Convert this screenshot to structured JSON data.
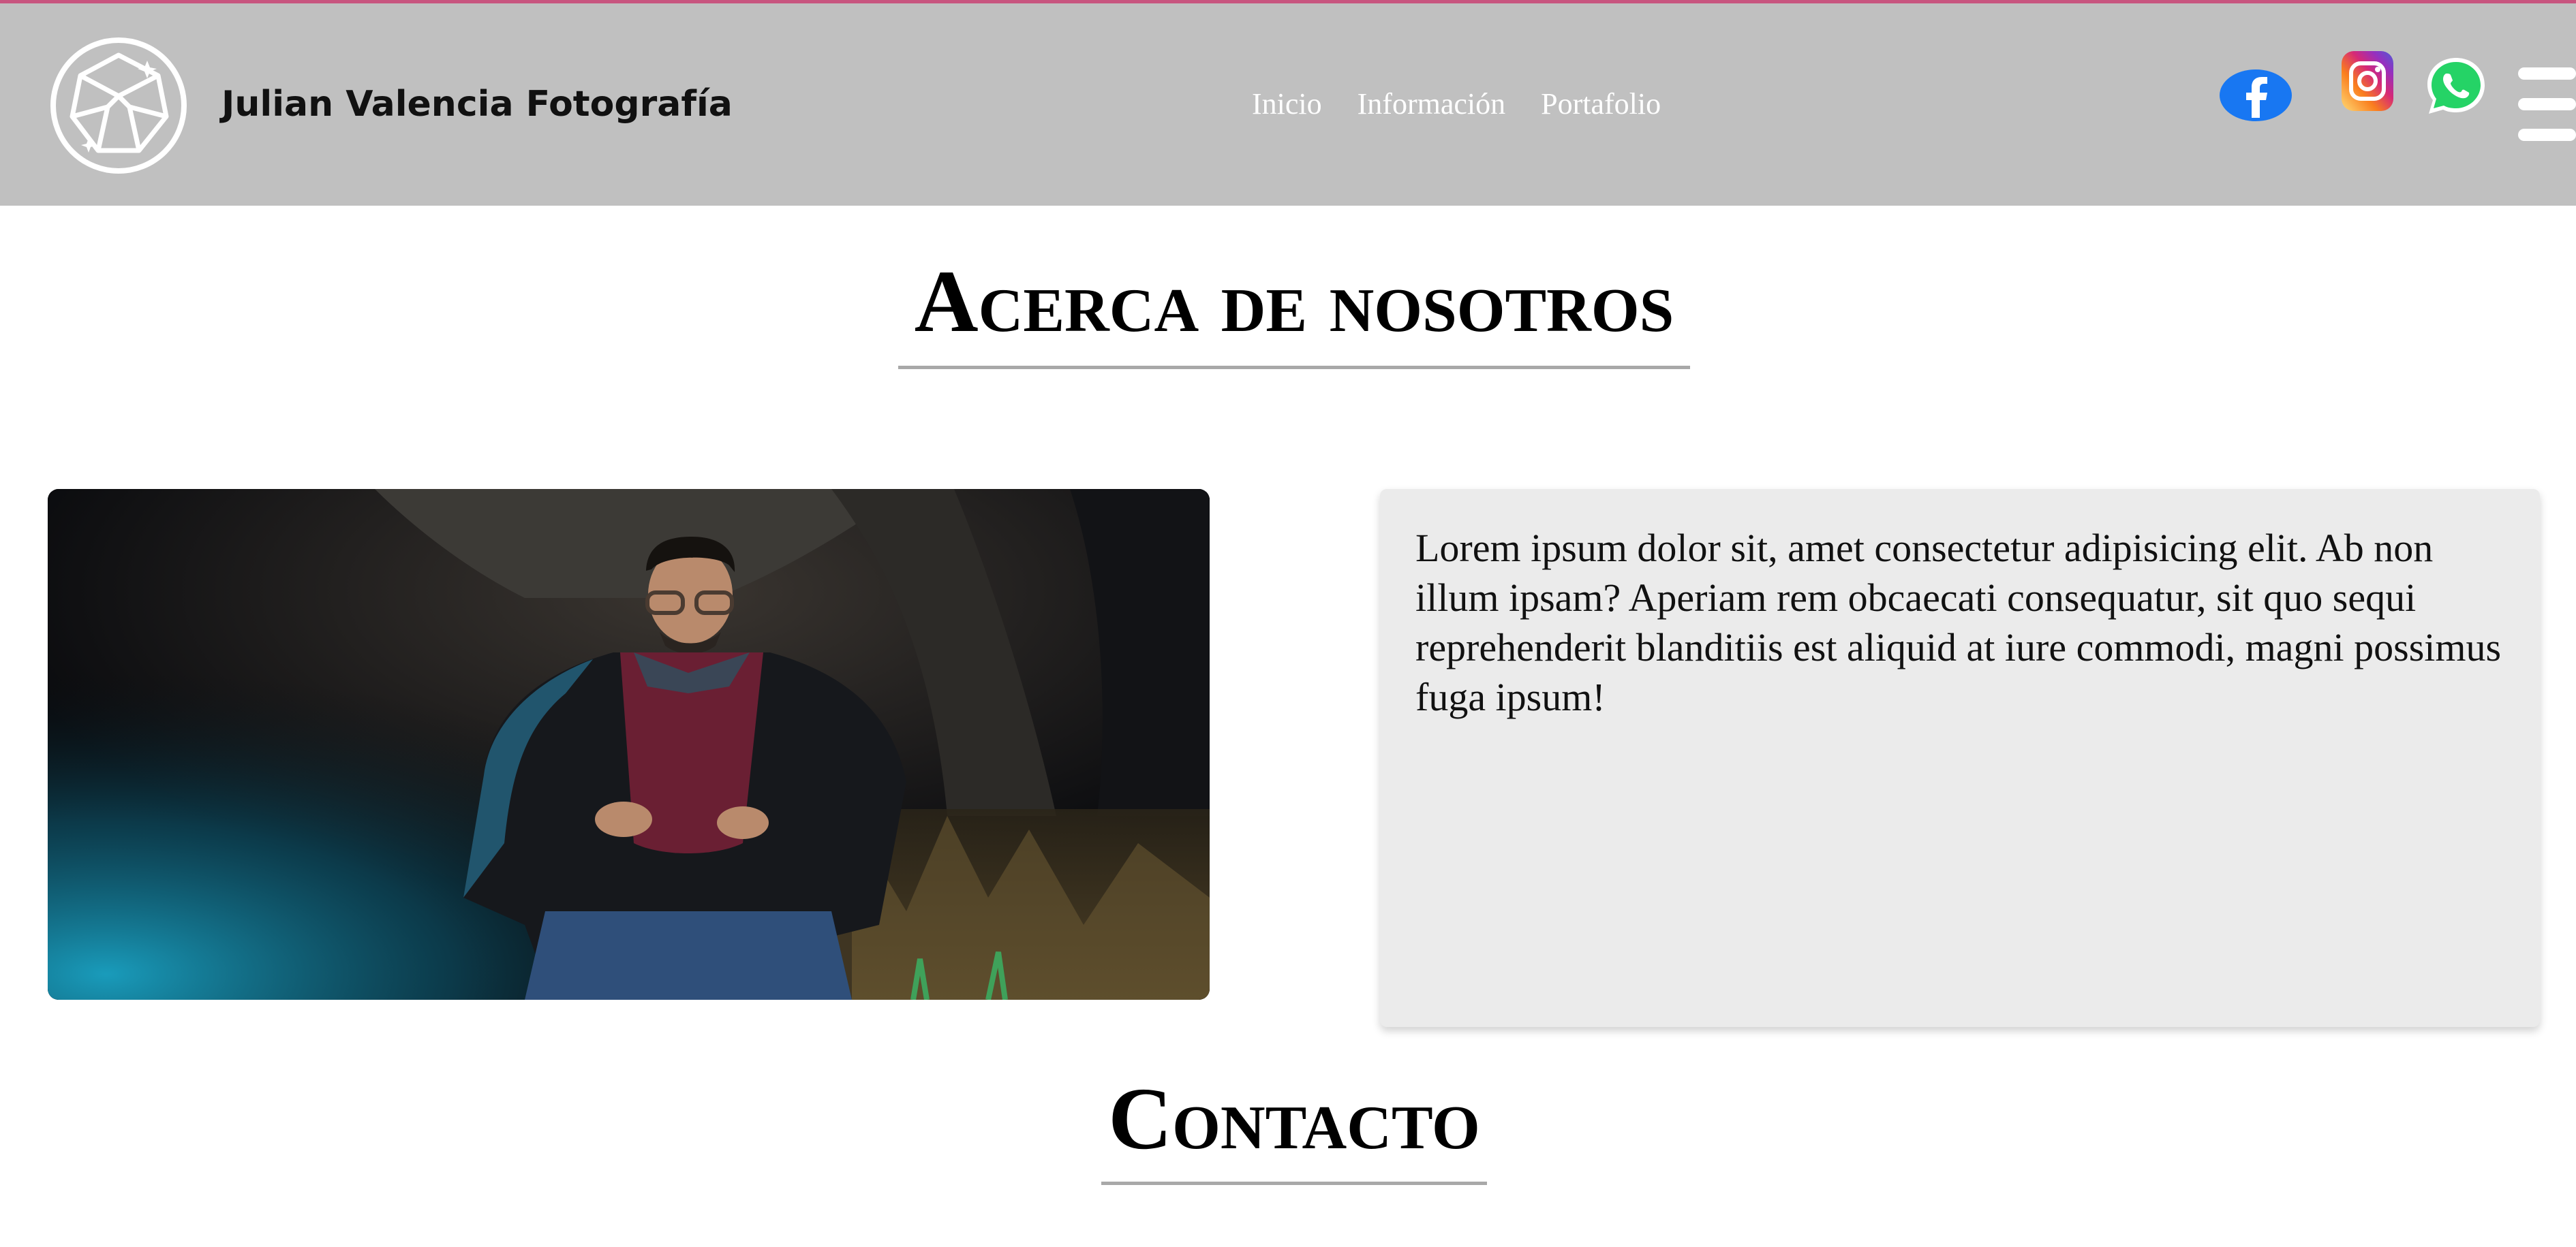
{
  "header": {
    "brand": "Julian Valencia Fotografía",
    "nav": [
      {
        "label": "Inicio"
      },
      {
        "label": "Información"
      },
      {
        "label": "Portafolio"
      }
    ],
    "social": [
      {
        "icon": "facebook-icon",
        "color": "#1877f2"
      },
      {
        "icon": "instagram-icon",
        "color": "#d62976"
      },
      {
        "icon": "whatsapp-icon",
        "color": "#25d366"
      }
    ],
    "menu_icon": "hamburger-menu-icon",
    "accent_top_border": "#c8557f",
    "background": "#c0c0c0"
  },
  "about": {
    "title": "Acerca de nosotros",
    "text": "Lorem ipsum dolor sit, amet consectetur adipisicing elit. Ab non illum ipsam? Aperiam rem obcaecati consequatur, sit quo sequi reprehenderit blanditiis est aliquid at iure commodi, magni possimus fuga ipsum!"
  },
  "contact": {
    "title": "Contacto"
  }
}
